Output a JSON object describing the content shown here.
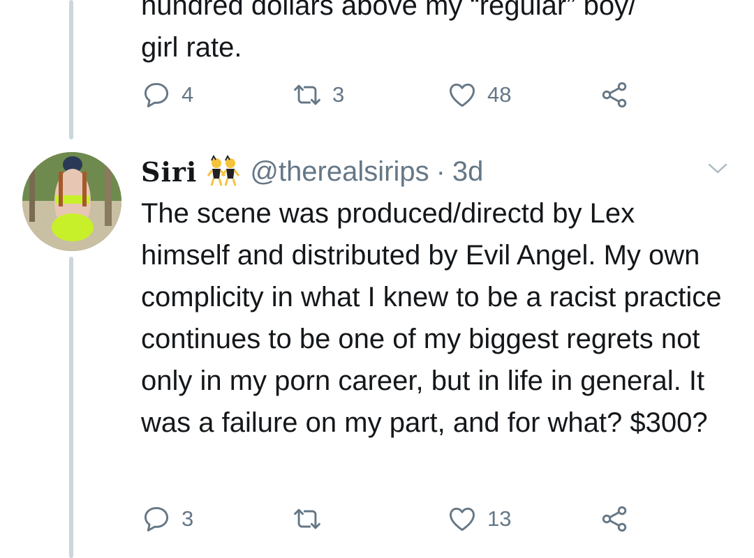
{
  "previous_tweet": {
    "text_cut_line": "hundred dollars above my “regular” boy/",
    "text_last_line": "girl rate.",
    "actions": {
      "reply_count": "4",
      "retweet_count": "3",
      "like_count": "48"
    }
  },
  "tweet": {
    "display_name": "Siri",
    "name_emoji_icon": "dancers-emoji-icon",
    "handle": "@therealsirips",
    "separator": "·",
    "time": "3d",
    "text": "The scene was produced/directd by Lex himself and distributed by Evil Angel. My own complicity in what I knew to be a racist practice continues to be one of my biggest regrets not only in my porn career, but in life in general. It was a failure on my part, and for what? $300?",
    "actions": {
      "reply_count": "3",
      "retweet_count": "",
      "like_count": "13"
    }
  },
  "icons": {
    "reply": "reply-icon",
    "retweet": "retweet-icon",
    "like": "heart-icon",
    "share": "share-icon",
    "menu": "chevron-down-icon"
  },
  "colors": {
    "text": "#14171a",
    "muted": "#657786",
    "thread_line": "#ccd6dd"
  }
}
